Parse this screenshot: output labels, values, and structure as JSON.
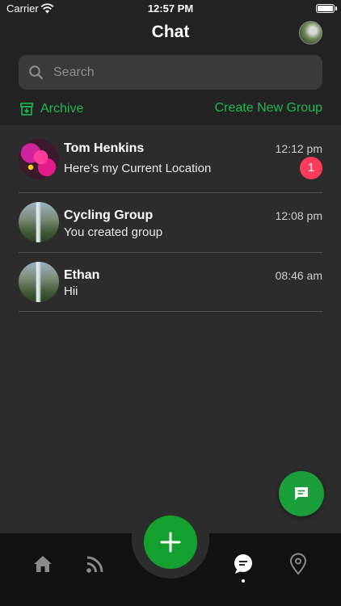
{
  "status_bar": {
    "carrier": "Carrier",
    "time": "12:57 PM"
  },
  "header": {
    "title": "Chat"
  },
  "search": {
    "placeholder": "Search"
  },
  "actions": {
    "archive_label": "Archive",
    "create_group_label": "Create New Group"
  },
  "chats": [
    {
      "name": "Tom Henkins",
      "message": "Here’s my Current Location",
      "time": "12:12 pm",
      "unread": "1"
    },
    {
      "name": "Cycling Group",
      "message": "You created group",
      "time": "12:08 pm"
    },
    {
      "name": "Ethan",
      "message": "Hii",
      "time": "08:46 am"
    }
  ],
  "colors": {
    "accent": "#1db954",
    "fab": "#1a9e3a",
    "badge": "#ff3b5c",
    "background": "#2c2c2c",
    "tabbar": "#111111"
  },
  "icons": {
    "tabs": [
      "home-icon",
      "feed-icon",
      "add-icon",
      "chat-icon",
      "location-pin-icon"
    ],
    "active_tab": "chat-icon"
  }
}
